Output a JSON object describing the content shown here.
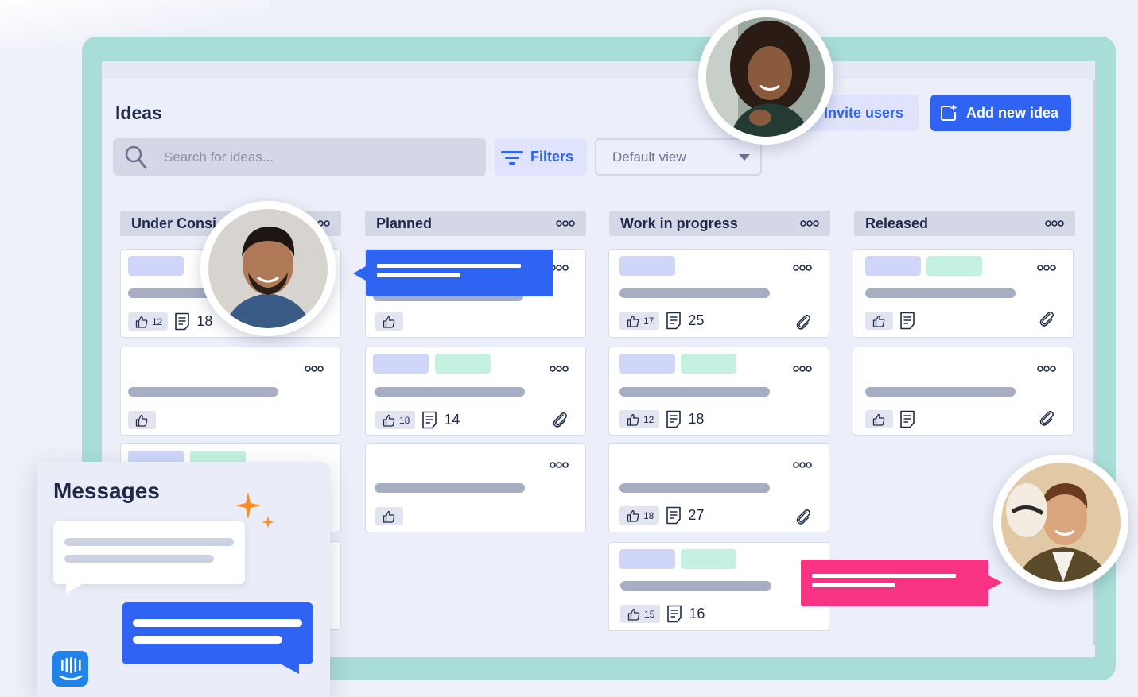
{
  "header": {
    "title": "Ideas",
    "invite_label": "Invite users",
    "add_label": "Add new idea"
  },
  "toolbar": {
    "search_placeholder": "Search for ideas...",
    "filters_label": "Filters",
    "view_value": "Default view"
  },
  "columns": [
    {
      "title": "Under Consi",
      "cards": [
        {
          "likes": "12",
          "comments": "18"
        },
        {
          "likes": "",
          "comments": ""
        },
        {
          "likes": "",
          "comments": ""
        },
        {
          "likes": "",
          "comments": ""
        }
      ]
    },
    {
      "title": "Planned",
      "cards": [
        {
          "likes": "",
          "comments": ""
        },
        {
          "likes": "18",
          "comments": "14"
        },
        {
          "likes": "",
          "comments": ""
        }
      ]
    },
    {
      "title": "Work in progress",
      "cards": [
        {
          "likes": "17",
          "comments": "25"
        },
        {
          "likes": "12",
          "comments": "18"
        },
        {
          "likes": "18",
          "comments": "27"
        },
        {
          "likes": "15",
          "comments": "16"
        }
      ]
    },
    {
      "title": "Released",
      "cards": [
        {
          "likes": "",
          "comments": ""
        },
        {
          "likes": "",
          "comments": ""
        }
      ]
    }
  ],
  "messages": {
    "title": "Messages"
  },
  "colors": {
    "accent": "#2f63f1",
    "pink": "#f93384",
    "teal_frame": "#a9ddd7",
    "chip_blue": "#cfd6f9",
    "chip_green": "#c4f1e0"
  }
}
